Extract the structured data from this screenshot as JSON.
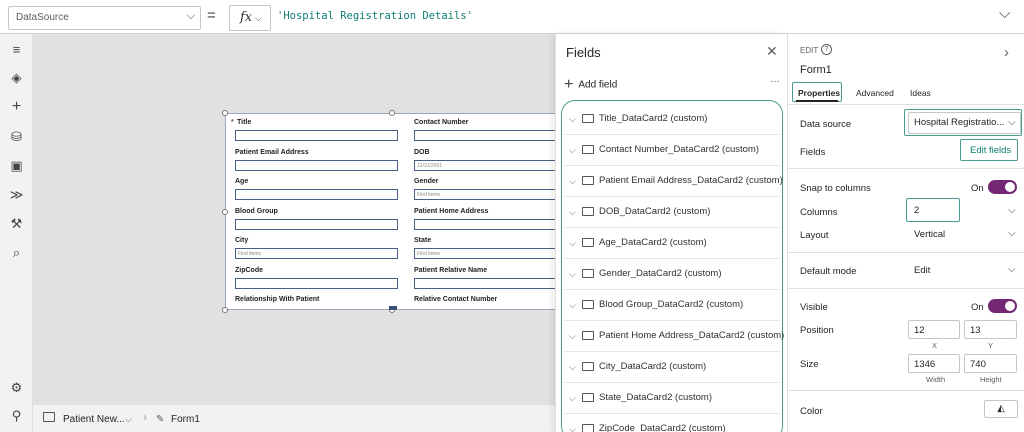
{
  "formula_bar": {
    "property": "DataSource",
    "equals": "=",
    "fx": "fx",
    "formula": "'Hospital Registration Details'"
  },
  "rail_icons": [
    "hamburger-icon",
    "layers-icon",
    "plus-icon",
    "database-icon",
    "media-icon",
    "flow-icon",
    "tools-icon",
    "search-icon",
    "settings-icon",
    "person-icon"
  ],
  "form": {
    "rows": [
      [
        {
          "label": "Title",
          "type": "text",
          "value": "",
          "required": true
        },
        {
          "label": "Contact Number",
          "type": "text",
          "value": ""
        }
      ],
      [
        {
          "label": "Patient Email Address",
          "type": "text",
          "value": ""
        },
        {
          "label": "DOB",
          "type": "text",
          "value": "12/31/2001"
        }
      ],
      [
        {
          "label": "Age",
          "type": "text",
          "value": ""
        },
        {
          "label": "Gender",
          "type": "text",
          "value": "Find items"
        }
      ],
      [
        {
          "label": "Blood Group",
          "type": "text",
          "value": ""
        },
        {
          "label": "Patient Home Address",
          "type": "text",
          "value": ""
        }
      ],
      [
        {
          "label": "City",
          "type": "dropdown",
          "value": "Find items"
        },
        {
          "label": "State",
          "type": "text",
          "value": "Find items"
        }
      ],
      [
        {
          "label": "ZipCode",
          "type": "text",
          "value": ""
        },
        {
          "label": "Patient Relative Name",
          "type": "text",
          "value": ""
        }
      ],
      [
        {
          "label": "Relationship With Patient",
          "type": "none",
          "value": ""
        },
        {
          "label": "Relative Contact Number",
          "type": "none",
          "value": ""
        }
      ]
    ]
  },
  "bottom_bar": {
    "screen": "Patient New...",
    "form": "Form1"
  },
  "fields_panel": {
    "title": "Fields",
    "add_field": "Add field",
    "more": "···",
    "fields": [
      "Title_DataCard2 (custom)",
      "Contact Number_DataCard2 (custom)",
      "Patient Email Address_DataCard2 (custom)",
      "DOB_DataCard2 (custom)",
      "Age_DataCard2 (custom)",
      "Gender_DataCard2 (custom)",
      "Blood Group_DataCard2 (custom)",
      "Patient Home Address_DataCard2 (custom)",
      "City_DataCard2 (custom)",
      "State_DataCard2 (custom)",
      "ZipCode_DataCard2 (custom)"
    ]
  },
  "props_panel": {
    "edit_label": "EDIT",
    "control_name": "Form1",
    "tabs": [
      "Properties",
      "Advanced",
      "Ideas"
    ],
    "data_source_label": "Data source",
    "data_source_value": "Hospital Registratio...",
    "fields_label": "Fields",
    "edit_fields": "Edit fields",
    "snap_label": "Snap to columns",
    "snap_state": "On",
    "columns_label": "Columns",
    "columns_value": "2",
    "layout_label": "Layout",
    "layout_value": "Vertical",
    "default_mode_label": "Default mode",
    "default_mode_value": "Edit",
    "visible_label": "Visible",
    "visible_state": "On",
    "position_label": "Position",
    "position_x": "12",
    "position_y": "13",
    "x_label": "X",
    "y_label": "Y",
    "size_label": "Size",
    "width_value": "1346",
    "height_value": "740",
    "width_label": "Width",
    "height_label": "Height",
    "color_label": "Color"
  },
  "colors": {
    "accent_teal": "#4a9c91",
    "toggle_purple": "#742774",
    "formula_teal": "#0f7c6d",
    "input_border": "#4a5f85"
  }
}
